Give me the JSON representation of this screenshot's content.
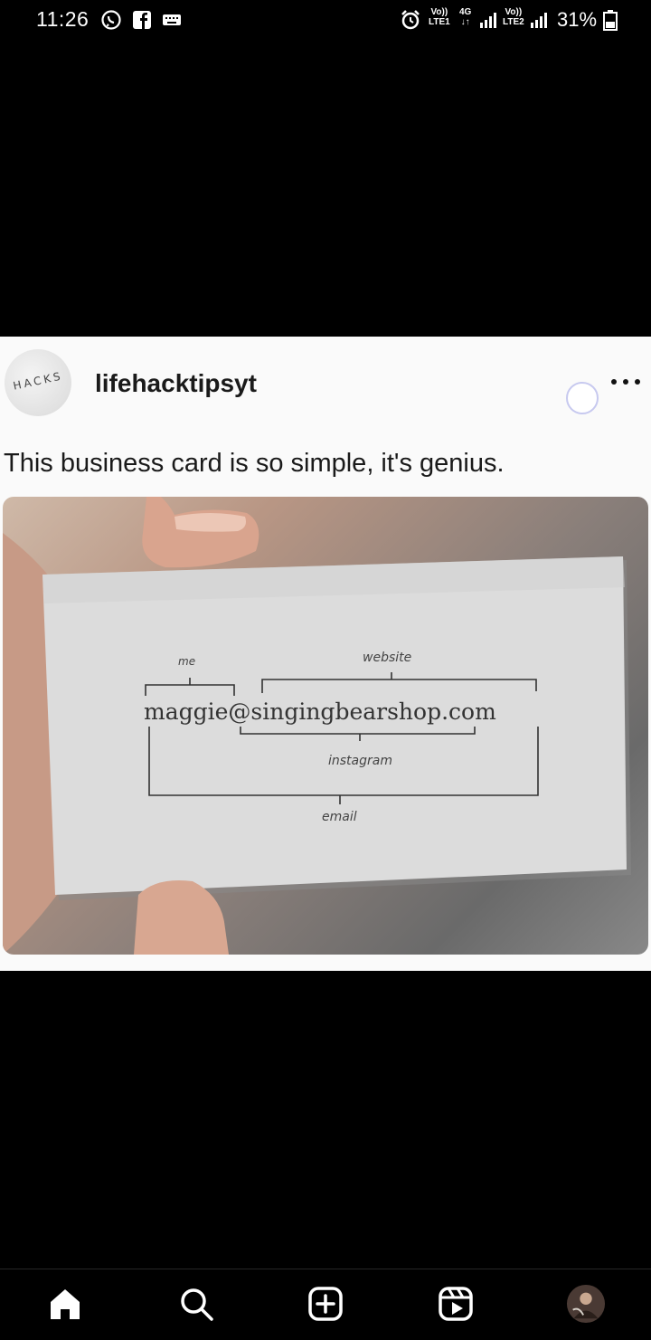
{
  "status_bar": {
    "time": "11:26",
    "sim1_label": "LTE1",
    "network_label": "4G",
    "sim2_label": "LTE2",
    "battery_percent": "31%",
    "vol_label": "Vo))"
  },
  "post": {
    "username": "lifehacktipsyt",
    "avatar_text": "HACKS",
    "caption": "This business card is so simple, it's genius.",
    "image": {
      "card_email": "maggie@singingbearshop.com",
      "annotation_me": "me",
      "annotation_website": "website",
      "annotation_instagram": "instagram",
      "annotation_email": "email"
    }
  },
  "bottom_nav": {
    "items": [
      "home-icon",
      "search-icon",
      "create-icon",
      "reels-icon",
      "profile-avatar"
    ]
  },
  "colors": {
    "background": "#000000",
    "post_background": "#fafafa",
    "loader_ring": "#c7c9ef"
  }
}
